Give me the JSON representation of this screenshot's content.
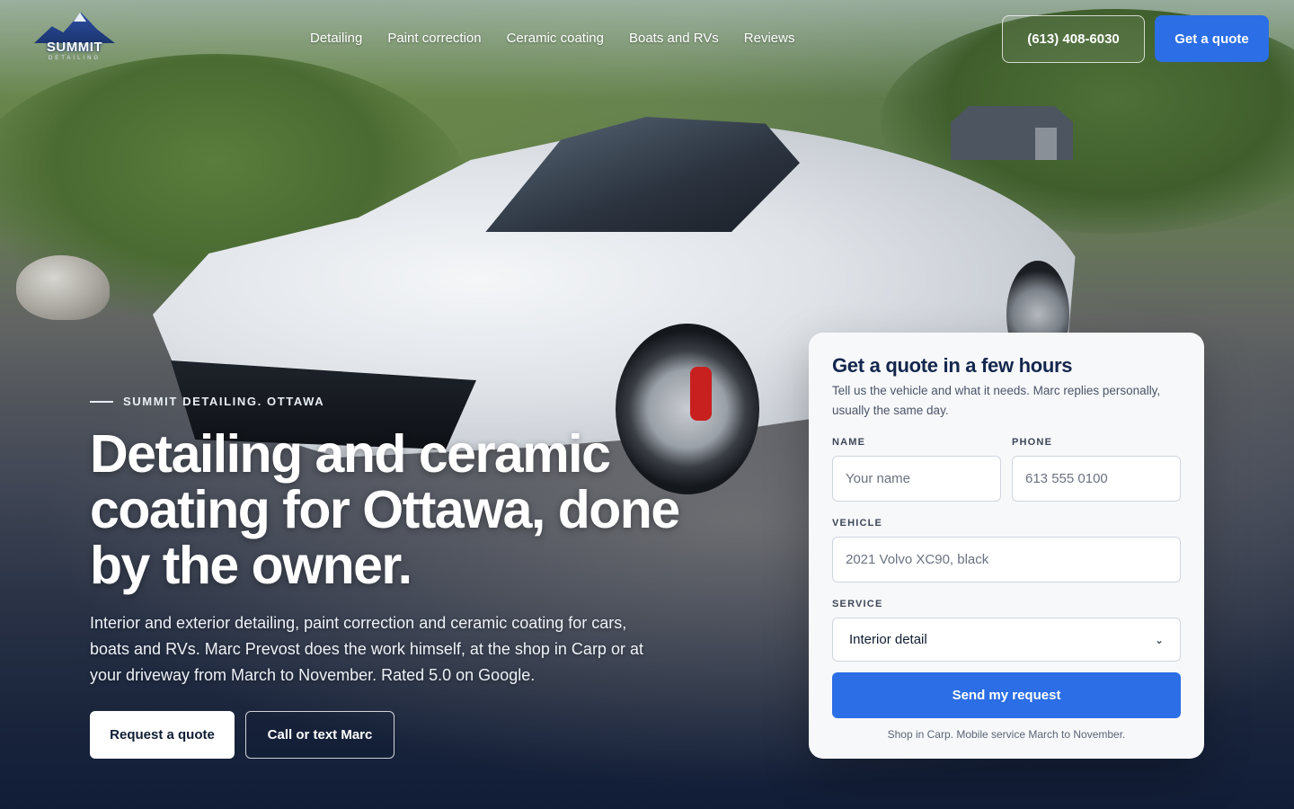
{
  "brand": {
    "name": "SUMMIT",
    "tagline": "DETAILING"
  },
  "nav": {
    "links": [
      "Detailing",
      "Paint correction",
      "Ceramic coating",
      "Boats and RVs",
      "Reviews"
    ],
    "phone": "(613) 408-6030",
    "quote_button": "Get a quote"
  },
  "hero": {
    "eyebrow": "SUMMIT DETAILING. OTTAWA",
    "headline": "Detailing and ceramic coating for Ottawa, done by the owner.",
    "lede": "Interior and exterior detailing, paint correction and ceramic coating for cars, boats and RVs. Marc Prevost does the work himself, at the shop in Carp or at your driveway from March to November. Rated 5.0 on Google.",
    "primary_cta": "Request a quote",
    "secondary_cta": "Call or text Marc"
  },
  "form": {
    "title": "Get a quote in a few hours",
    "subtitle": "Tell us the vehicle and what it needs. Marc replies personally, usually the same day.",
    "name_label": "NAME",
    "name_placeholder": "Your name",
    "phone_label": "PHONE",
    "phone_placeholder": "613 555 0100",
    "vehicle_label": "VEHICLE",
    "vehicle_placeholder": "2021 Volvo XC90, black",
    "service_label": "SERVICE",
    "service_selected": "Interior detail",
    "submit": "Send my request",
    "note": "Shop in Carp. Mobile service March to November."
  },
  "colors": {
    "accent": "#2b6ee6",
    "heading": "#13264d"
  }
}
